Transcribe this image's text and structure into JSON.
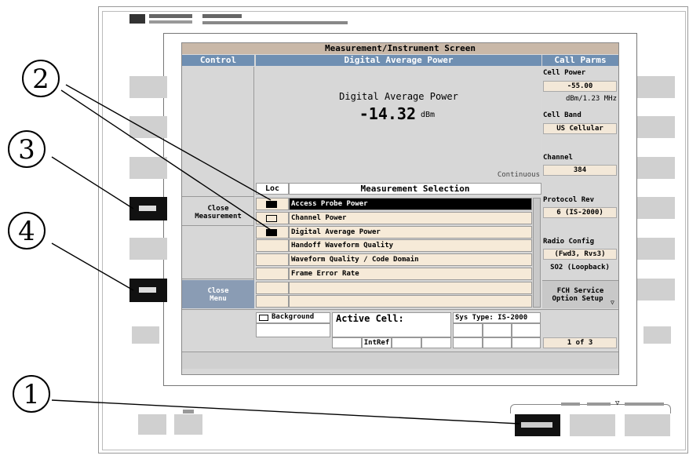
{
  "screen": {
    "title": "Measurement/Instrument Screen",
    "control_header": "Control",
    "measurement_header": "Digital Average Power",
    "call_parms_header": "Call Parms",
    "measurement_name": "Digital Average Power",
    "measurement_value": "-14.32",
    "measurement_unit": "dBm",
    "status": "Continuous",
    "close_measurement_1": "Close",
    "close_measurement_2": "Measurement",
    "close_menu_1": "Close",
    "close_menu_2": "Menu"
  },
  "selection": {
    "loc_header": "Loc",
    "header": "Measurement Selection",
    "items": [
      "Access Probe Power",
      "Channel Power",
      "Digital Average Power",
      "Handoff Waveform Quality",
      "Waveform Quality / Code Domain",
      "Frame Error Rate"
    ]
  },
  "call_parms": {
    "cell_power_label": "Cell Power",
    "cell_power_value": "-55.00",
    "cell_power_unit": "dBm/1.23 MHz",
    "cell_band_label": "Cell Band",
    "cell_band_value": "US Cellular",
    "channel_label": "Channel",
    "channel_value": "384",
    "protocol_label": "Protocol Rev",
    "protocol_value": "6 (IS-2000)",
    "radio_label": "Radio Config",
    "radio_value": "(Fwd3, Rvs3)",
    "so_value": "SO2 (Loopback)",
    "fch_1": "FCH Service",
    "fch_2": "Option Setup",
    "page": "1 of 3"
  },
  "status_bar": {
    "background": "Background",
    "active_cell": "Active Cell:",
    "sys_type": "Sys Type: IS-2000",
    "intref": "IntRef"
  },
  "callouts": [
    "1",
    "2",
    "3",
    "4"
  ]
}
